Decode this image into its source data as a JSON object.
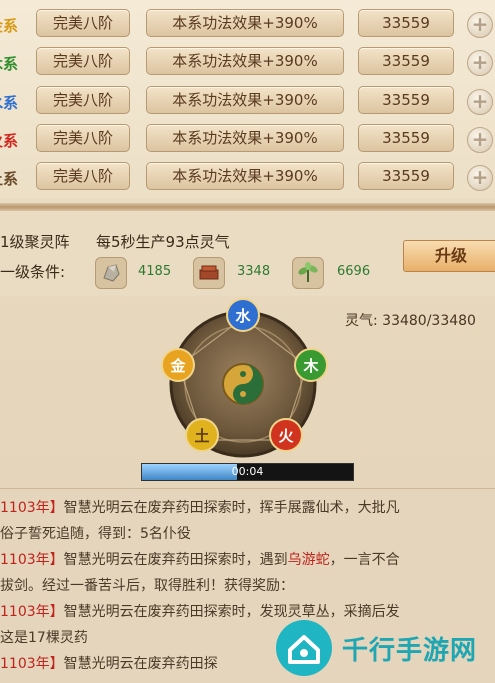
{
  "colors": {
    "metal": "#d89a12",
    "wood": "#2f8f2f",
    "water": "#2e6fd1",
    "fire": "#d0281e",
    "earth": "#6a4a2a",
    "accent_green": "#2f7a2f",
    "accent_red": "#c0231c",
    "watermark": "#1fa6b3"
  },
  "attributes": [
    {
      "element": "金系",
      "stage": "完美八阶",
      "effect": "本系功法效果+390%",
      "value": "33559",
      "add_icon": "+"
    },
    {
      "element": "木系",
      "stage": "完美八阶",
      "effect": "本系功法效果+390%",
      "value": "33559",
      "add_icon": "+"
    },
    {
      "element": "水系",
      "stage": "完美八阶",
      "effect": "本系功法效果+390%",
      "value": "33559",
      "add_icon": "+"
    },
    {
      "element": "火系",
      "stage": "完美八阶",
      "effect": "本系功法效果+390%",
      "value": "33559",
      "add_icon": "+"
    },
    {
      "element": "土系",
      "stage": "完美八阶",
      "effect": "本系功法效果+390%",
      "value": "33559",
      "add_icon": "+"
    }
  ],
  "formation": {
    "level": "1级聚灵阵",
    "production": "每5秒生产93点灵气",
    "upgrade_condition_label": "一级条件:",
    "resources": [
      {
        "icon": "stone-resource-icon",
        "value": "4185"
      },
      {
        "icon": "wood-resource-icon",
        "value": "3348"
      },
      {
        "icon": "herb-resource-icon",
        "value": "6696"
      }
    ],
    "upgrade_button": "升级",
    "qi_label": "灵气: 33480/33480"
  },
  "wheel": {
    "elements": [
      "水",
      "木",
      "火",
      "土",
      "金"
    ],
    "center_icon": "yin-yang-icon"
  },
  "progress": {
    "time": "00:04",
    "fraction": 0.45
  },
  "log": [
    {
      "year": "1103年】",
      "segments": [
        {
          "t": "智慧光明云在废弃药田探索时，挥手展露仙术，大批凡",
          "c": "normal"
        }
      ]
    },
    {
      "year": "",
      "segments": [
        {
          "t": "俗子誓死追随，得到：5名仆役",
          "c": "normal"
        }
      ]
    },
    {
      "year": "1103年】",
      "segments": [
        {
          "t": "智慧光明云在废弃药田探索时，遇到",
          "c": "normal"
        },
        {
          "t": "乌游蛇",
          "c": "red"
        },
        {
          "t": "，一言不合",
          "c": "normal"
        }
      ]
    },
    {
      "year": "",
      "segments": [
        {
          "t": "拔剑。经过一番苦斗后，取得胜利！获得奖励：",
          "c": "normal"
        }
      ]
    },
    {
      "year": "1103年】",
      "segments": [
        {
          "t": "智慧光明云在废弃药田探索时，发现灵草丛，采摘后发",
          "c": "normal"
        }
      ]
    },
    {
      "year": "",
      "segments": [
        {
          "t": "这是17棵灵药",
          "c": "normal"
        }
      ]
    },
    {
      "year": "1103年】",
      "segments": [
        {
          "t": "智慧光明云在废弃药田探",
          "c": "normal"
        }
      ]
    }
  ],
  "watermark": {
    "text": "千行手游网"
  }
}
